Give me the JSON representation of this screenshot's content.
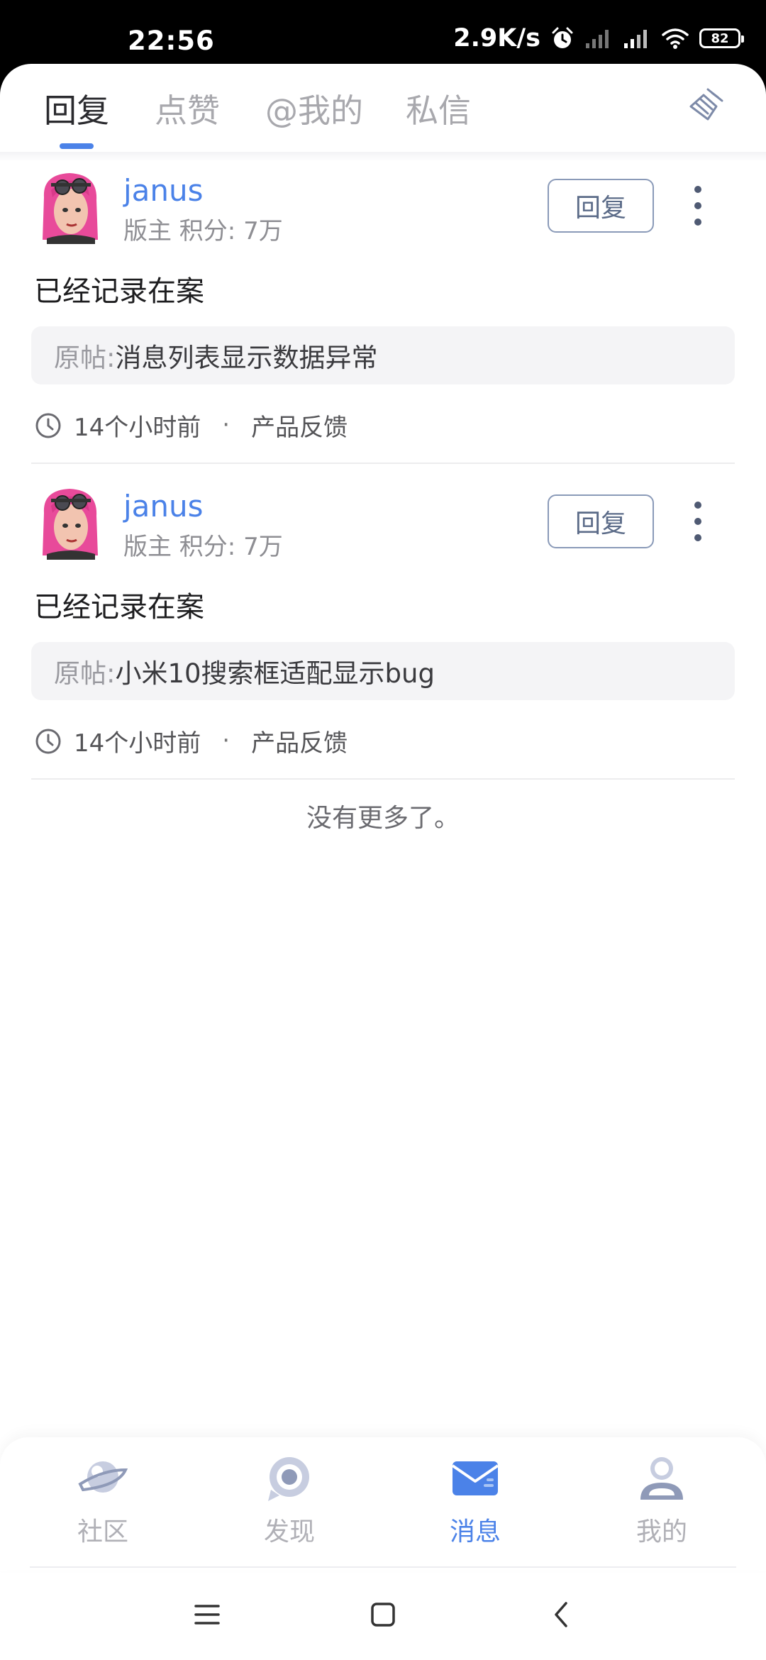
{
  "status_bar": {
    "time": "22:56",
    "net_speed": "2.9K/s",
    "battery": "82",
    "icons": [
      "alarm-icon",
      "signal-icon",
      "signal-icon",
      "wifi-icon",
      "battery-icon"
    ]
  },
  "tabs": [
    {
      "label": "回复",
      "active": true
    },
    {
      "label": "点赞",
      "active": false
    },
    {
      "label": "@我的",
      "active": false
    },
    {
      "label": "私信",
      "active": false
    }
  ],
  "clear_icon": "broom-icon",
  "messages": [
    {
      "username": "janus",
      "meta": "版主 积分: 7万",
      "reply_label": "回复",
      "content": "已经记录在案",
      "quote_label": "原帖: ",
      "quote_text": "消息列表显示数据异常",
      "time": "14个小时前",
      "separator": "·",
      "category": "产品反馈"
    },
    {
      "username": "janus",
      "meta": "版主 积分: 7万",
      "reply_label": "回复",
      "content": "已经记录在案",
      "quote_label": "原帖: ",
      "quote_text": "小米10搜索框适配显示bug",
      "time": "14个小时前",
      "separator": "·",
      "category": "产品反馈"
    }
  ],
  "no_more": "没有更多了。",
  "bottom_nav": [
    {
      "label": "社区",
      "icon": "planet-icon",
      "active": false
    },
    {
      "label": "发现",
      "icon": "discover-icon",
      "active": false
    },
    {
      "label": "消息",
      "icon": "mail-icon",
      "active": true
    },
    {
      "label": "我的",
      "icon": "profile-icon",
      "active": false
    }
  ],
  "colors": {
    "accent": "#4b82e8",
    "inactive": "#b0b0b6",
    "text": "#1d1d1f"
  }
}
